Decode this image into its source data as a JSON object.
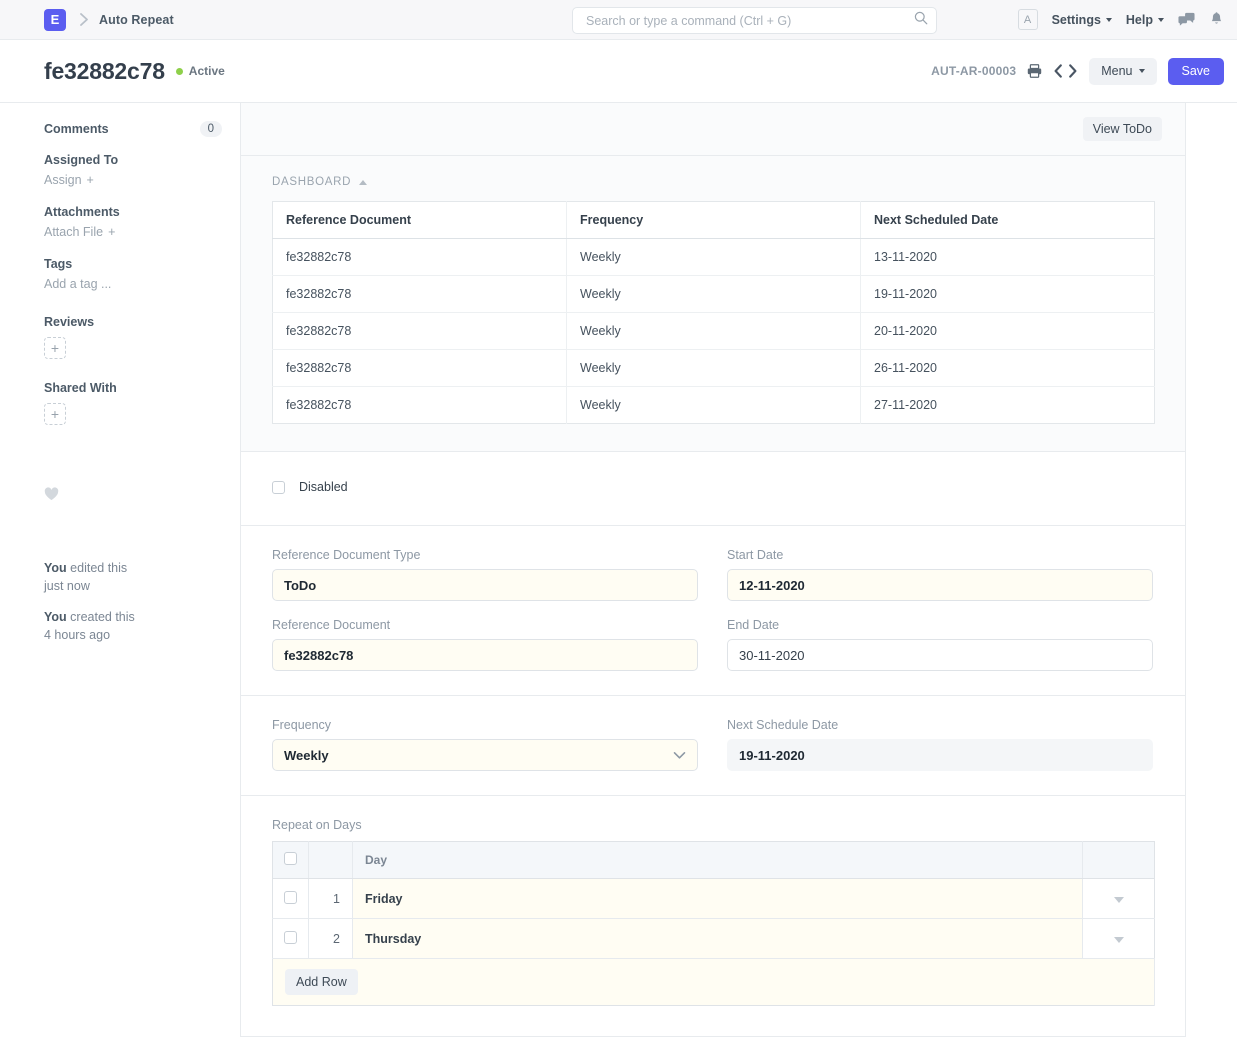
{
  "navbar": {
    "logo_letter": "E",
    "breadcrumb": "Auto Repeat",
    "search": {
      "placeholder": "Search or type a command (Ctrl + G)",
      "value": ""
    },
    "avatar_letter": "A",
    "settings_label": "Settings",
    "help_label": "Help",
    "icons": [
      "search-icon",
      "chat-icon",
      "bell-icon"
    ]
  },
  "pagehead": {
    "title": "fe32882c78",
    "status": "Active",
    "status_color": "#8ed04a",
    "doc_id": "AUT-AR-00003",
    "menu_label": "Menu",
    "save_label": "Save",
    "save_color": "#5b5df0"
  },
  "sidebar": {
    "comments_label": "Comments",
    "comments_count": "0",
    "assigned_to_label": "Assigned To",
    "assign_action": "Assign",
    "attachments_label": "Attachments",
    "attach_action": "Attach File",
    "tags_label": "Tags",
    "tags_placeholder": "Add a tag ...",
    "reviews_label": "Reviews",
    "shared_with_label": "Shared With",
    "plus": "+",
    "activity": [
      {
        "actor": "You",
        "action": " edited this",
        "time": "just now"
      },
      {
        "actor": "You",
        "action": " created this",
        "time": "4 hours ago"
      }
    ]
  },
  "toolbar": {
    "view_todo_label": "View ToDo"
  },
  "dashboard": {
    "section_label": "DASHBOARD",
    "columns": [
      "Reference Document",
      "Frequency",
      "Next Scheduled Date"
    ],
    "rows": [
      [
        "fe32882c78",
        "Weekly",
        "13-11-2020"
      ],
      [
        "fe32882c78",
        "Weekly",
        "19-11-2020"
      ],
      [
        "fe32882c78",
        "Weekly",
        "20-11-2020"
      ],
      [
        "fe32882c78",
        "Weekly",
        "26-11-2020"
      ],
      [
        "fe32882c78",
        "Weekly",
        "27-11-2020"
      ]
    ]
  },
  "disabled_field": {
    "label": "Disabled",
    "checked": false
  },
  "form": {
    "reference_document_type": {
      "label": "Reference Document Type",
      "value": "ToDo"
    },
    "start_date": {
      "label": "Start Date",
      "value": "12-11-2020"
    },
    "reference_document": {
      "label": "Reference Document",
      "value": "fe32882c78"
    },
    "end_date": {
      "label": "End Date",
      "value": "30-11-2020"
    },
    "frequency": {
      "label": "Frequency",
      "value": "Weekly"
    },
    "next_schedule_date": {
      "label": "Next Schedule Date",
      "value": "19-11-2020"
    }
  },
  "repeat_on_days": {
    "label": "Repeat on Days",
    "column_day": "Day",
    "rows": [
      {
        "idx": "1",
        "day": "Friday"
      },
      {
        "idx": "2",
        "day": "Thursday"
      }
    ],
    "add_row_label": "Add Row"
  }
}
